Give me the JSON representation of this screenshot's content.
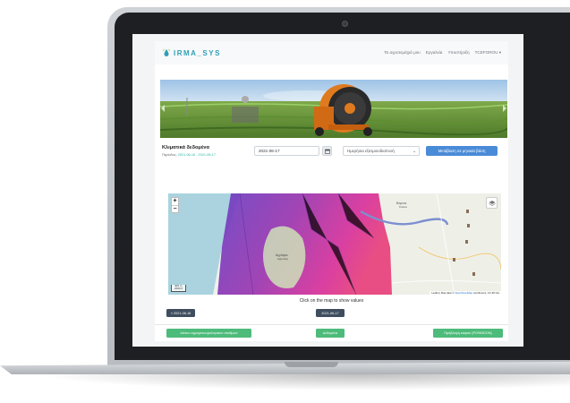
{
  "app": {
    "logo_text": "IRMA_SYS",
    "logo_icon": "drop-signal-icon",
    "brand_color": "#2e9fb8"
  },
  "nav": {
    "links": [
      "Τα αγροτεμάχιά μου",
      "Εργαλεία",
      "Υποστήριξη",
      "TCEFOROU"
    ],
    "user_caret": "▾"
  },
  "climate": {
    "title": "Κλιματικά δεδομένα",
    "period_label": "Περίοδος:",
    "period_range": "2021-06-16 - 2021-06-17",
    "date_value": "2021-06-17",
    "calendar_icon": "calendar-icon",
    "select_value": "Ημερήσια εξατμισοδιαπνοή",
    "monthly_button": "Μετάβαση σε μηνιαία βάση"
  },
  "map": {
    "zoom_in": "+",
    "zoom_out": "−",
    "layers_icon": "layers-icon",
    "scale_top": "400 m",
    "scale_bottom": "2000 ft",
    "attribution_prefix": "Leaflet | Map data ©",
    "attribution_link": "OpenStreetMap",
    "attribution_suffix": "contributors, CC-BY-SA",
    "place_1": "Βόρειοι",
    "place_1b": "Κύκλοι",
    "place_2": "Αγγλάρα",
    "place_2b": "Αγροτική"
  },
  "hint_text": "Click on the map to show values",
  "dates": {
    "prev": "« 2021-06-16",
    "current": "2021-06-17"
  },
  "footer": {
    "stations_button": "Δίκτυο αγρομετεωρολογικών σταθμών",
    "data_button": "Δεδομένα",
    "forecast_button": "Πρόβλεψη καιρού (POSEIDON)"
  },
  "colors": {
    "primary_button": "#4a8bd8",
    "success_button": "#4dbb7a",
    "dark_tag": "#3f4e5f",
    "map_magenta": "#c8309a",
    "map_purple": "#6a3fc4"
  }
}
